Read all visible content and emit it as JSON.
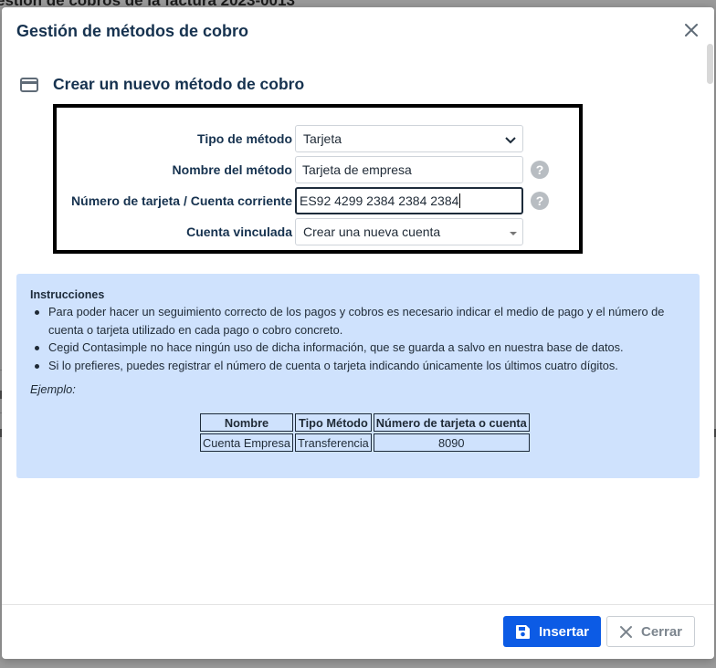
{
  "background": {
    "title": "estión de cobros de la factura 2023-0013"
  },
  "modal": {
    "title": "Gestión de métodos de cobro",
    "close_icon": "close-icon"
  },
  "section": {
    "icon": "credit-card-icon",
    "title": "Crear un nuevo método de cobro"
  },
  "form": {
    "tipo": {
      "label": "Tipo de método",
      "value": "Tarjeta"
    },
    "nombre": {
      "label": "Nombre del método",
      "value": "Tarjeta de empresa"
    },
    "numero": {
      "label": "Número de tarjeta / Cuenta corriente",
      "value": "ES92 4299 2384 2384 2384"
    },
    "cuenta": {
      "label": "Cuenta vinculada",
      "value": "Crear una nueva cuenta"
    },
    "help_glyph": "?"
  },
  "instructions": {
    "title": "Instrucciones",
    "items": [
      "Para poder hacer un seguimiento correcto de los pagos y cobros es necesario indicar el medio de pago y el número de cuenta o tarjeta utilizado en cada pago o cobro concreto.",
      "Cegid Contasimple no hace ningún uso de dicha información, que se guarda a salvo en nuestra base de datos.",
      "Si lo prefieres, puedes registrar el número de cuenta o tarjeta indicando únicamente los últimos cuatro dígitos."
    ],
    "example_label": "Ejemplo:",
    "table": {
      "headers": [
        "Nombre",
        "Tipo Método",
        "Número de tarjeta o cuenta"
      ],
      "row": [
        "Cuenta Empresa",
        "Transferencia",
        "8090"
      ]
    }
  },
  "footer": {
    "insert_label": "Insertar",
    "close_label": "Cerrar"
  },
  "colors": {
    "primary": "#0c5be5",
    "title": "#16324f",
    "instructions_bg": "#cfe2fd"
  }
}
